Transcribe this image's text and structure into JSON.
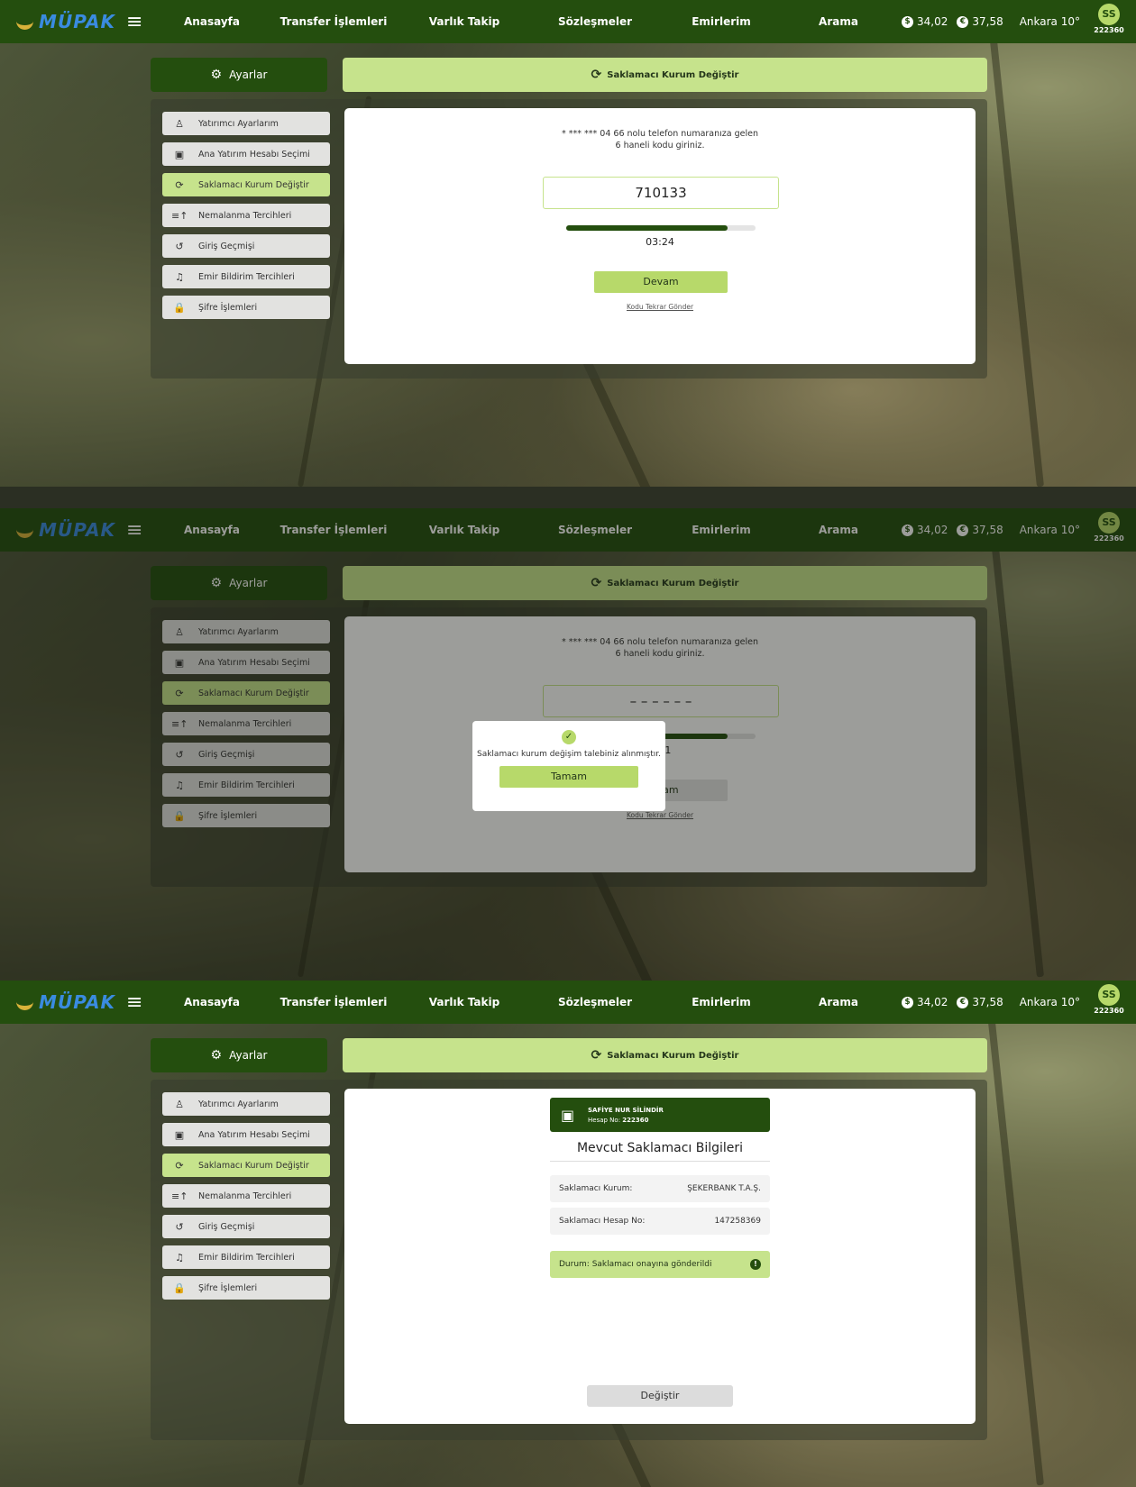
{
  "brand": {
    "logo_text": "MÜPAK",
    "menu_icon": "hamburger-icon"
  },
  "nav": [
    "Anasayfa",
    "Transfer İşlemleri",
    "Varlık Takip",
    "Sözleşmeler",
    "Emirlerim",
    "Arama"
  ],
  "rates": {
    "usd": "34,02",
    "eur": "37,58"
  },
  "weather": "Ankara 10°",
  "user": {
    "initials": "SS",
    "number": "222360"
  },
  "settings_tab": "Ayarlar",
  "page_header": "Saklamacı Kurum Değiştir",
  "menu": [
    {
      "label": "Yatırımcı Ayarlarım",
      "icon": "user-icon"
    },
    {
      "label": "Ana Yatırım Hesabı Seçimi",
      "icon": "wallet-icon"
    },
    {
      "label": "Saklamacı Kurum Değiştir",
      "icon": "refresh-icon",
      "active": true
    },
    {
      "label": "Nemalanma Tercihleri",
      "icon": "sort-icon"
    },
    {
      "label": "Giriş Geçmişi",
      "icon": "history-icon"
    },
    {
      "label": "Emir Bildirim Tercihleri",
      "icon": "bell-icon"
    },
    {
      "label": "Şifre İşlemleri",
      "icon": "lock-icon"
    }
  ],
  "otp": {
    "message_line1": "* *** *** 04 66 nolu telefon numaranıza gelen",
    "message_line2": "6 haneli kodu giriniz.",
    "code": "710133",
    "code_empty": "– – – – – –",
    "progress": 0.85,
    "timer": "03:24",
    "submit": "Devam",
    "resend": "Kodu Tekrar Gönder"
  },
  "modal": {
    "message": "Saklamacı kurum değişim talebiniz alınmıştır.",
    "button": "Tamam",
    "behind_timer": "3:21",
    "behind_button": "Devam"
  },
  "account": {
    "name": "SAFİYE NUR SİLİNDİR",
    "number_label": "Hesap No:",
    "number": "222360",
    "section_title": "Mevcut Saklamacı Bilgileri",
    "custodian_label": "Saklamacı Kurum:",
    "custodian_value": "ŞEKERBANK T.A.Ş.",
    "custodian_account_label": "Saklamacı Hesap No:",
    "custodian_account_value": "147258369",
    "status": "Durum: Saklamacı onayına gönderildi",
    "change_button": "Değiştir"
  },
  "colors": {
    "primary_dark": "#244e0e",
    "accent": "#c6e38c",
    "button": "#b7d96a"
  }
}
